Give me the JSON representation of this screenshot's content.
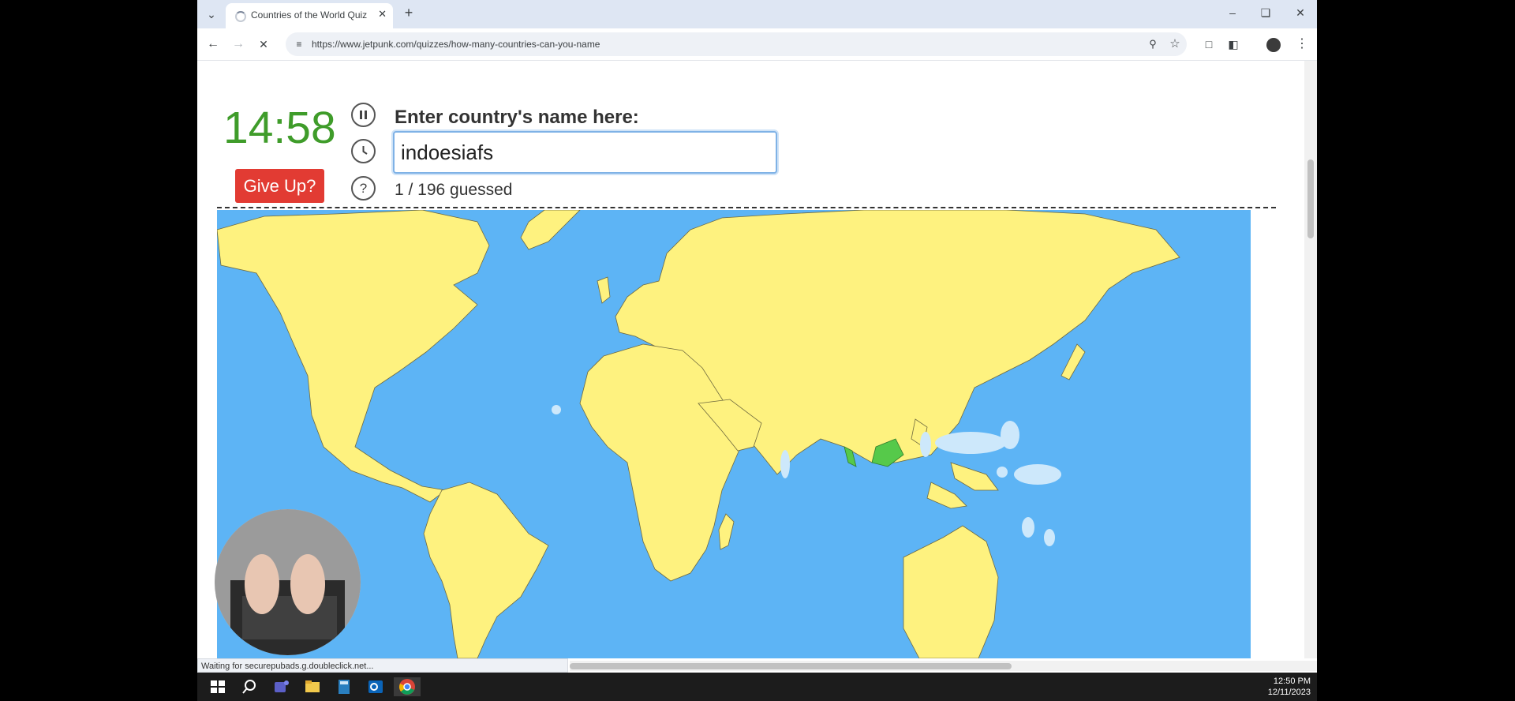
{
  "browser": {
    "tab_title": "Countries of the World Quiz",
    "url": "https://www.jetpunk.com/quizzes/how-many-countries-can-you-name",
    "status_text": "Waiting for securepubads.g.doubleclick.net..."
  },
  "quiz": {
    "timer": "14:58",
    "give_up_label": "Give Up?",
    "prompt": "Enter country's name here:",
    "answer_value": "indoesiafs",
    "progress_text": "1 / 196 guessed"
  },
  "map": {
    "ocean_color": "#5db4f5",
    "land_color": "#fef27f",
    "guessed_color": "#56c94a",
    "guessed_country": "Indonesia",
    "hint_area_color": "#cde8fb"
  },
  "taskbar": {
    "time": "12:50 PM",
    "date": "12/11/2023"
  },
  "icons": [
    "tab-list-icon",
    "loading-spinner-icon",
    "close-tab-icon",
    "new-tab-icon",
    "minimize-icon",
    "maximize-icon",
    "close-window-icon",
    "back-icon",
    "forward-icon",
    "stop-icon",
    "site-info-icon",
    "zoom-icon",
    "bookmark-star-icon",
    "extensions-icon",
    "side-panel-icon",
    "profile-avatar-icon",
    "menu-icon",
    "pause-icon",
    "clock-icon",
    "help-icon",
    "windows-start-icon",
    "search-icon",
    "teams-icon",
    "file-explorer-icon",
    "calculator-icon",
    "outlook-icon",
    "chrome-icon"
  ]
}
